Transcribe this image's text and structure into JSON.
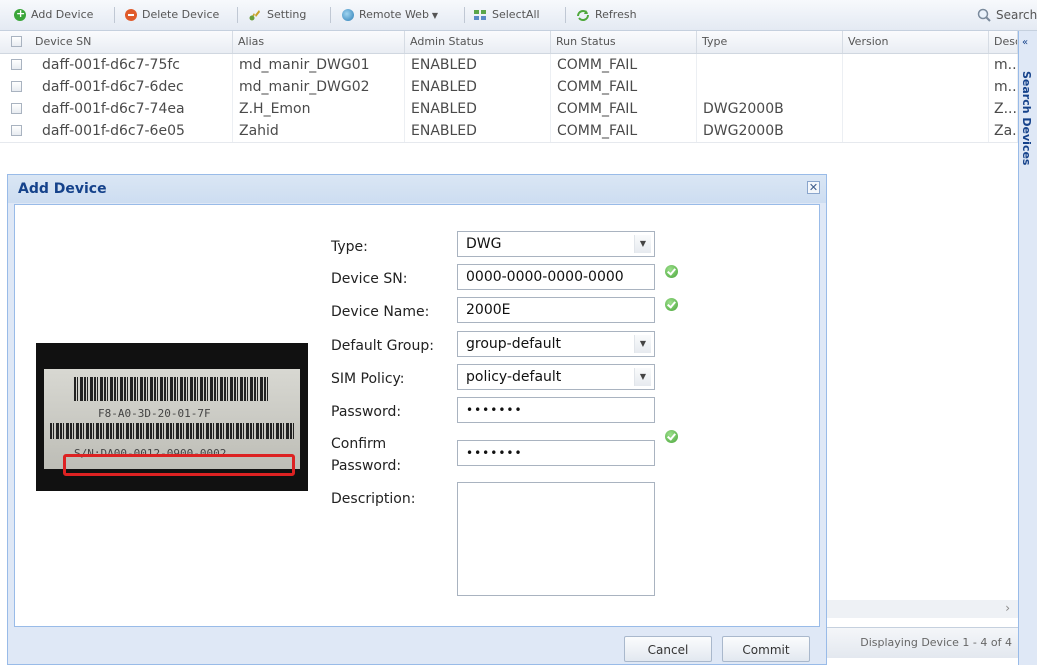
{
  "toolbar": {
    "add_device": "Add Device",
    "delete_device": "Delete Device",
    "setting": "Setting",
    "remote_web": "Remote Web",
    "select_all": "SelectAll",
    "refresh": "Refresh",
    "search": "Search"
  },
  "grid": {
    "columns": [
      "Device SN",
      "Alias",
      "Admin Status",
      "Run Status",
      "Type",
      "Version",
      "Desc"
    ],
    "rows": [
      {
        "sn": "daff-001f-d6c7-75fc",
        "alias": "md_manir_DWG01",
        "admin": "ENABLED",
        "run": "COMM_FAIL",
        "type": "",
        "version": "",
        "desc": "m.."
      },
      {
        "sn": "daff-001f-d6c7-6dec",
        "alias": "md_manir_DWG02",
        "admin": "ENABLED",
        "run": "COMM_FAIL",
        "type": "",
        "version": "",
        "desc": "m.."
      },
      {
        "sn": "daff-001f-d6c7-74ea",
        "alias": "Z.H_Emon",
        "admin": "ENABLED",
        "run": "COMM_FAIL",
        "type": "DWG2000B",
        "version": "",
        "desc": "Z..."
      },
      {
        "sn": "daff-001f-d6c7-6e05",
        "alias": "Zahid",
        "admin": "ENABLED",
        "run": "COMM_FAIL",
        "type": "DWG2000B",
        "version": "",
        "desc": "Za.."
      }
    ],
    "pager": "Displaying Device 1 - 4 of 4"
  },
  "side_panel": {
    "title": "Search Devices"
  },
  "dialog": {
    "title": "Add Device",
    "photo": {
      "mac": "F8-A0-3D-20-01-7F",
      "sn": "S/N:DA00-0012-0900-0002"
    },
    "labels": {
      "type": "Type:",
      "device_sn": "Device SN:",
      "device_name": "Device Name:",
      "default_group": "Default Group:",
      "sim_policy": "SIM Policy:",
      "password": "Password:",
      "confirm_1": "Confirm",
      "confirm_2": "Password:",
      "description": "Description:"
    },
    "values": {
      "type": "DWG",
      "device_sn": "0000-0000-0000-0000",
      "device_name": "2000E",
      "default_group": "group-default",
      "sim_policy": "policy-default",
      "password": "•••••••",
      "confirm_password": "•••••••",
      "description": ""
    },
    "cancel": "Cancel",
    "commit": "Commit"
  }
}
